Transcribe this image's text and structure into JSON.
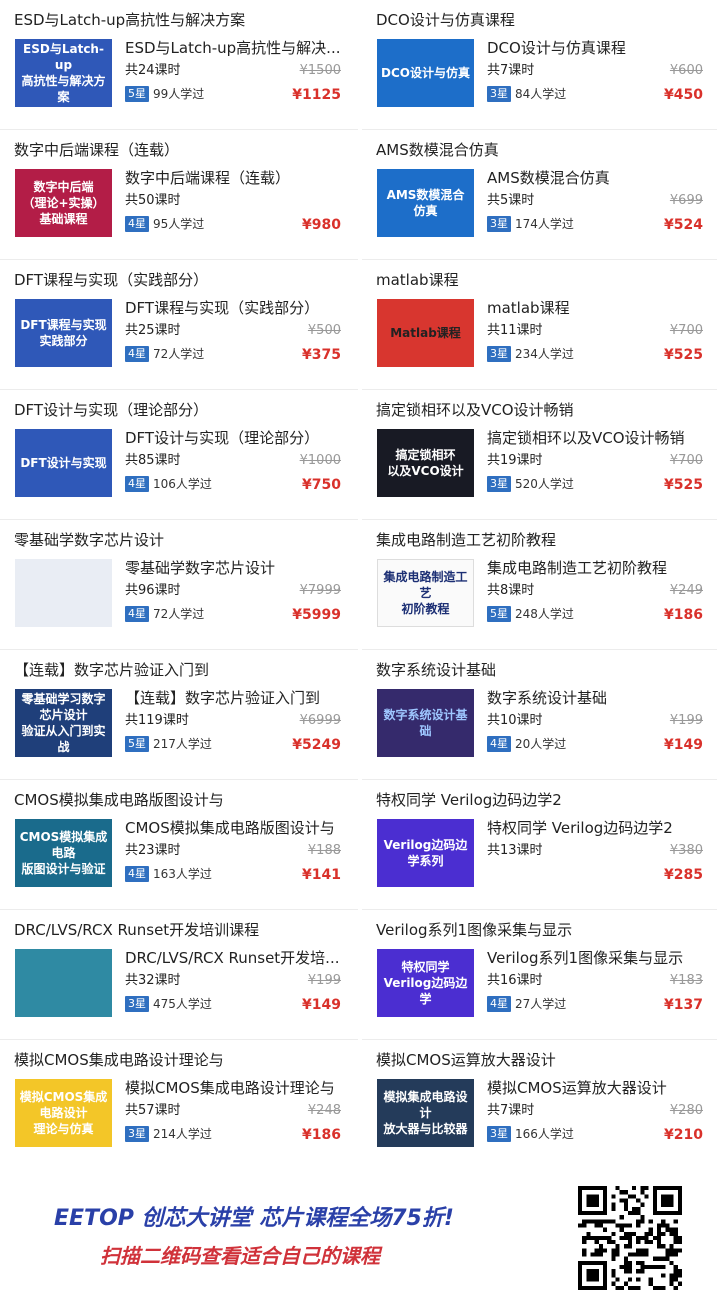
{
  "courses": [
    {
      "heading": "ESD与Latch-up高抗性与解决方案",
      "name": "ESD与Latch-up高抗性与解决...",
      "lessons": "共24课时",
      "original_price": "¥1500",
      "star": "5星",
      "learned": "99人学过",
      "price": "¥1125",
      "thumb_text": "ESD与Latch-up\n高抗性与解决方案"
    },
    {
      "heading": "DCO设计与仿真课程",
      "name": "DCO设计与仿真课程",
      "lessons": "共7课时",
      "original_price": "¥600",
      "star": "3星",
      "learned": "84人学过",
      "price": "¥450",
      "thumb_text": "DCO设计与仿真"
    },
    {
      "heading": "数字中后端课程（连载）",
      "name": "数字中后端课程（连载）",
      "lessons": "共50课时",
      "original_price": "",
      "star": "4星",
      "learned": "95人学过",
      "price": "¥980",
      "thumb_text": "数字中后端\n（理论+实操）基础课程"
    },
    {
      "heading": "AMS数模混合仿真",
      "name": "AMS数模混合仿真",
      "lessons": "共5课时",
      "original_price": "¥699",
      "star": "3星",
      "learned": "174人学过",
      "price": "¥524",
      "thumb_text": "AMS数模混合\n仿真"
    },
    {
      "heading": "DFT课程与实现（实践部分）",
      "name": "DFT课程与实现（实践部分）",
      "lessons": "共25课时",
      "original_price": "¥500",
      "star": "4星",
      "learned": "72人学过",
      "price": "¥375",
      "thumb_text": "DFT课程与实现\n实践部分"
    },
    {
      "heading": "matlab课程",
      "name": "matlab课程",
      "lessons": "共11课时",
      "original_price": "¥700",
      "star": "3星",
      "learned": "234人学过",
      "price": "¥525",
      "thumb_text": "Matlab课程"
    },
    {
      "heading": "DFT设计与实现（理论部分）",
      "name": "DFT设计与实现（理论部分）",
      "lessons": "共85课时",
      "original_price": "¥1000",
      "star": "4星",
      "learned": "106人学过",
      "price": "¥750",
      "thumb_text": "DFT设计与实现"
    },
    {
      "heading": "搞定锁相环以及VCO设计畅销",
      "name": "搞定锁相环以及VCO设计畅销",
      "lessons": "共19课时",
      "original_price": "¥700",
      "star": "3星",
      "learned": "520人学过",
      "price": "¥525",
      "thumb_text": "搞定锁相环\n以及VCO设计"
    },
    {
      "heading": "零基础学数字芯片设计",
      "name": "零基础学数字芯片设计",
      "lessons": "共96课时",
      "original_price": "¥7999",
      "star": "4星",
      "learned": "72人学过",
      "price": "¥5999",
      "thumb_text": ""
    },
    {
      "heading": "集成电路制造工艺初阶教程",
      "name": "集成电路制造工艺初阶教程",
      "lessons": "共8课时",
      "original_price": "¥249",
      "star": "5星",
      "learned": "248人学过",
      "price": "¥186",
      "thumb_text": "集成电路制造工艺\n初阶教程"
    },
    {
      "heading": "【连载】数字芯片验证入门到",
      "name": "【连载】数字芯片验证入门到",
      "lessons": "共119课时",
      "original_price": "¥6999",
      "star": "5星",
      "learned": "217人学过",
      "price": "¥5249",
      "thumb_text": "零基础学习数字芯片设计\n验证从入门到实战"
    },
    {
      "heading": "数字系统设计基础",
      "name": "数字系统设计基础",
      "lessons": "共10课时",
      "original_price": "¥199",
      "star": "4星",
      "learned": "20人学过",
      "price": "¥149",
      "thumb_text": "数字系统设计基础"
    },
    {
      "heading": "CMOS模拟集成电路版图设计与",
      "name": "CMOS模拟集成电路版图设计与",
      "lessons": "共23课时",
      "original_price": "¥188",
      "star": "4星",
      "learned": "163人学过",
      "price": "¥141",
      "thumb_text": "CMOS模拟集成电路\n版图设计与验证"
    },
    {
      "heading": "特权同学 Verilog边码边学2",
      "name": "特权同学 Verilog边码边学2",
      "lessons": "共13课时",
      "original_price": "¥380",
      "star": "",
      "learned": "",
      "price": "¥285",
      "thumb_text": "Verilog边码边学系列"
    },
    {
      "heading": "DRC/LVS/RCX Runset开发培训课程",
      "name": "DRC/LVS/RCX Runset开发培...",
      "lessons": "共32课时",
      "original_price": "¥199",
      "star": "3星",
      "learned": "475人学过",
      "price": "¥149",
      "thumb_text": ""
    },
    {
      "heading": "Verilog系列1图像采集与显示",
      "name": "Verilog系列1图像采集与显示",
      "lessons": "共16课时",
      "original_price": "¥183",
      "star": "4星",
      "learned": "27人学过",
      "price": "¥137",
      "thumb_text": "特权同学 Verilog边码边学"
    },
    {
      "heading": "模拟CMOS集成电路设计理论与",
      "name": "模拟CMOS集成电路设计理论与",
      "lessons": "共57课时",
      "original_price": "¥248",
      "star": "3星",
      "learned": "214人学过",
      "price": "¥186",
      "thumb_text": "模拟CMOS集成电路设计\n理论与仿真"
    },
    {
      "heading": "模拟CMOS运算放大器设计",
      "name": "模拟CMOS运算放大器设计",
      "lessons": "共7课时",
      "original_price": "¥280",
      "star": "3星",
      "learned": "166人学过",
      "price": "¥210",
      "thumb_text": "模拟集成电路设计\n放大器与比较器"
    }
  ],
  "thumb_styles": [
    "t-blue",
    "t-sky",
    "t-rose",
    "t-sky",
    "t-blue",
    "t-red",
    "t-blue",
    "t-dark",
    "t-light",
    "t-purewhite",
    "t-navy",
    "t-purple",
    "t-teal",
    "t-violet",
    "t-tealpale",
    "t-violet",
    "t-yellow",
    "t-navy2"
  ],
  "banner": {
    "line1": "EETOP 创芯大讲堂  芯片课程全场75折!",
    "line2": "扫描二维码查看适合自己的课程"
  },
  "colors": {
    "price": "#d9312b",
    "star_badge": "#2f6fc0",
    "banner_blue": "#2a40a8",
    "banner_red": "#d0323a"
  }
}
